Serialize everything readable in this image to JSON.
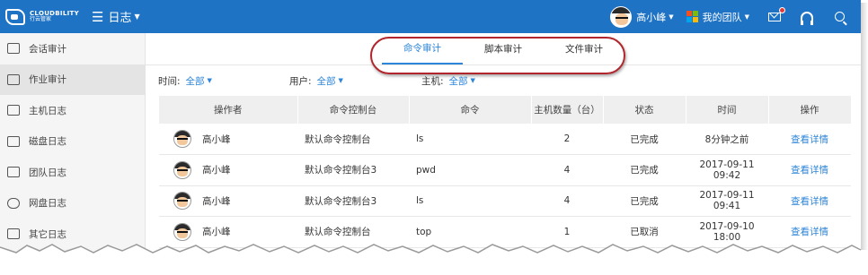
{
  "header": {
    "logo_en": "CLOUDBILITY",
    "logo_cn": "行云管家",
    "menu_icon": "menu-icon",
    "title": "日志",
    "user_name": "高小峰",
    "team_label": "我的团队",
    "icons": [
      "mail-icon",
      "headset-icon",
      "search-icon"
    ],
    "brand_color": "#1e73c4"
  },
  "sidebar": {
    "items": [
      {
        "label": "会话审计",
        "icon": "session-audit-icon",
        "active": false
      },
      {
        "label": "作业审计",
        "icon": "job-audit-icon",
        "active": true
      },
      {
        "label": "主机日志",
        "icon": "monitor-icon",
        "active": false
      },
      {
        "label": "磁盘日志",
        "icon": "disk-icon",
        "active": false
      },
      {
        "label": "团队日志",
        "icon": "team-icon",
        "active": false
      },
      {
        "label": "网盘日志",
        "icon": "cloud-icon",
        "active": false
      },
      {
        "label": "其它日志",
        "icon": "other-log-icon",
        "active": false
      }
    ]
  },
  "tabs": [
    {
      "label": "命令审计",
      "active": true
    },
    {
      "label": "脚本审计",
      "active": false
    },
    {
      "label": "文件审计",
      "active": false
    }
  ],
  "filters": [
    {
      "label": "时间:",
      "value": "全部"
    },
    {
      "label": "用户:",
      "value": "全部"
    },
    {
      "label": "主机:",
      "value": "全部"
    }
  ],
  "table": {
    "columns": [
      "操作者",
      "命令控制台",
      "命令",
      "主机数量（台）",
      "状态",
      "时间",
      "操作"
    ],
    "rows": [
      {
        "operator": "高小峰",
        "console": "默认命令控制台",
        "command": "ls",
        "host_count": "2",
        "status": "已完成",
        "status_kind": "done",
        "time": "8分钟之前",
        "action": "查看详情"
      },
      {
        "operator": "高小峰",
        "console": "默认命令控制台3",
        "command": "pwd",
        "host_count": "4",
        "status": "已完成",
        "status_kind": "done",
        "time": "2017-09-11 09:42",
        "action": "查看详情"
      },
      {
        "operator": "高小峰",
        "console": "默认命令控制台3",
        "command": "ls",
        "host_count": "4",
        "status": "已完成",
        "status_kind": "done",
        "time": "2017-09-11 09:41",
        "action": "查看详情"
      },
      {
        "operator": "高小峰",
        "console": "默认命令控制台",
        "command": "top",
        "host_count": "1",
        "status": "已取消",
        "status_kind": "cancel",
        "time": "2017-09-10 18:00",
        "action": "查看详情"
      }
    ]
  },
  "colors": {
    "accent": "#2d86d9",
    "done": "#3bb33b",
    "cancelled": "#bdbdbd",
    "highlight_ring": "#b0262c"
  }
}
